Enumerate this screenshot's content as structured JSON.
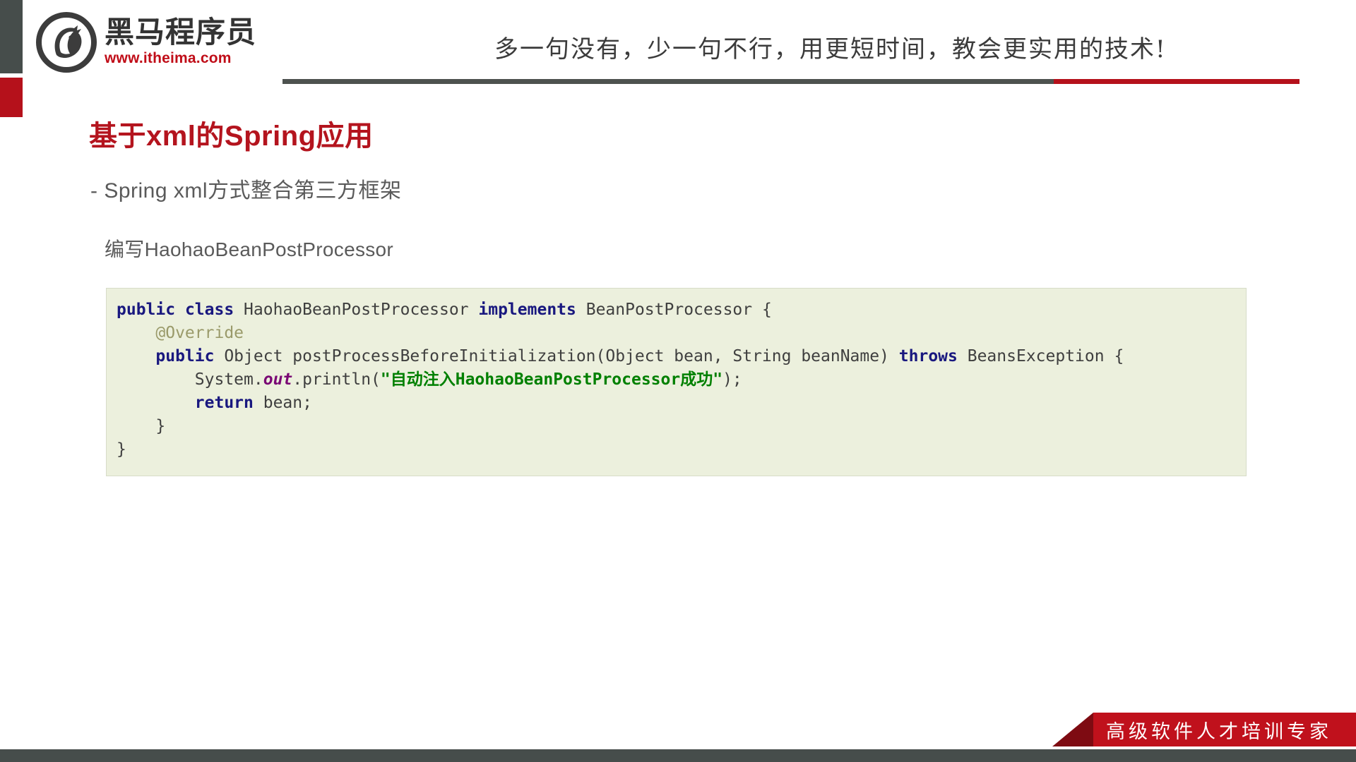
{
  "theme": {
    "brand_red": "#b4141e",
    "dark_gray": "#464d4b",
    "code_bg": "#ecf0dd",
    "keyword_color": "#19187f",
    "string_color": "#008000",
    "annotation_color": "#9a9a6a",
    "field_color": "#7a0874"
  },
  "header": {
    "logo_name": "黑马程序员",
    "logo_url": "www.itheima.com",
    "logo_icon": "horse-head-circle-logo",
    "tagline": "多一句没有，少一句不行，用更短时间，教会更实用的技术!"
  },
  "slide": {
    "title": "基于xml的Spring应用",
    "subtitle": "- Spring xml方式整合第三方框架",
    "section_label": "编写HaohaoBeanPostProcessor"
  },
  "code": {
    "language": "java",
    "lines": [
      {
        "tokens": [
          {
            "text": "public",
            "style": "kw"
          },
          {
            "text": " ",
            "style": "plain"
          },
          {
            "text": "class",
            "style": "kw"
          },
          {
            "text": " HaohaoBeanPostProcessor ",
            "style": "plain"
          },
          {
            "text": "implements",
            "style": "kw"
          },
          {
            "text": " BeanPostProcessor {",
            "style": "plain"
          }
        ]
      },
      {
        "tokens": [
          {
            "text": "    ",
            "style": "plain"
          },
          {
            "text": "@Override",
            "style": "ann"
          }
        ]
      },
      {
        "tokens": [
          {
            "text": "    ",
            "style": "plain"
          },
          {
            "text": "public",
            "style": "kw"
          },
          {
            "text": " Object postProcessBeforeInitialization(Object bean, String beanName) ",
            "style": "plain"
          },
          {
            "text": "throws",
            "style": "kw"
          },
          {
            "text": " BeansException {",
            "style": "plain"
          }
        ]
      },
      {
        "tokens": [
          {
            "text": "        System.",
            "style": "plain"
          },
          {
            "text": "out",
            "style": "fld"
          },
          {
            "text": ".println(",
            "style": "plain"
          },
          {
            "text": "\"自动注入HaohaoBeanPostProcessor成功\"",
            "style": "str"
          },
          {
            "text": ");",
            "style": "plain"
          }
        ]
      },
      {
        "tokens": [
          {
            "text": "        ",
            "style": "plain"
          },
          {
            "text": "return",
            "style": "kw"
          },
          {
            "text": " bean;",
            "style": "plain"
          }
        ]
      },
      {
        "tokens": [
          {
            "text": "    }",
            "style": "plain"
          }
        ]
      },
      {
        "tokens": [
          {
            "text": "}",
            "style": "plain"
          }
        ]
      }
    ]
  },
  "footer": {
    "ribbon_text": "高级软件人才培训专家"
  }
}
